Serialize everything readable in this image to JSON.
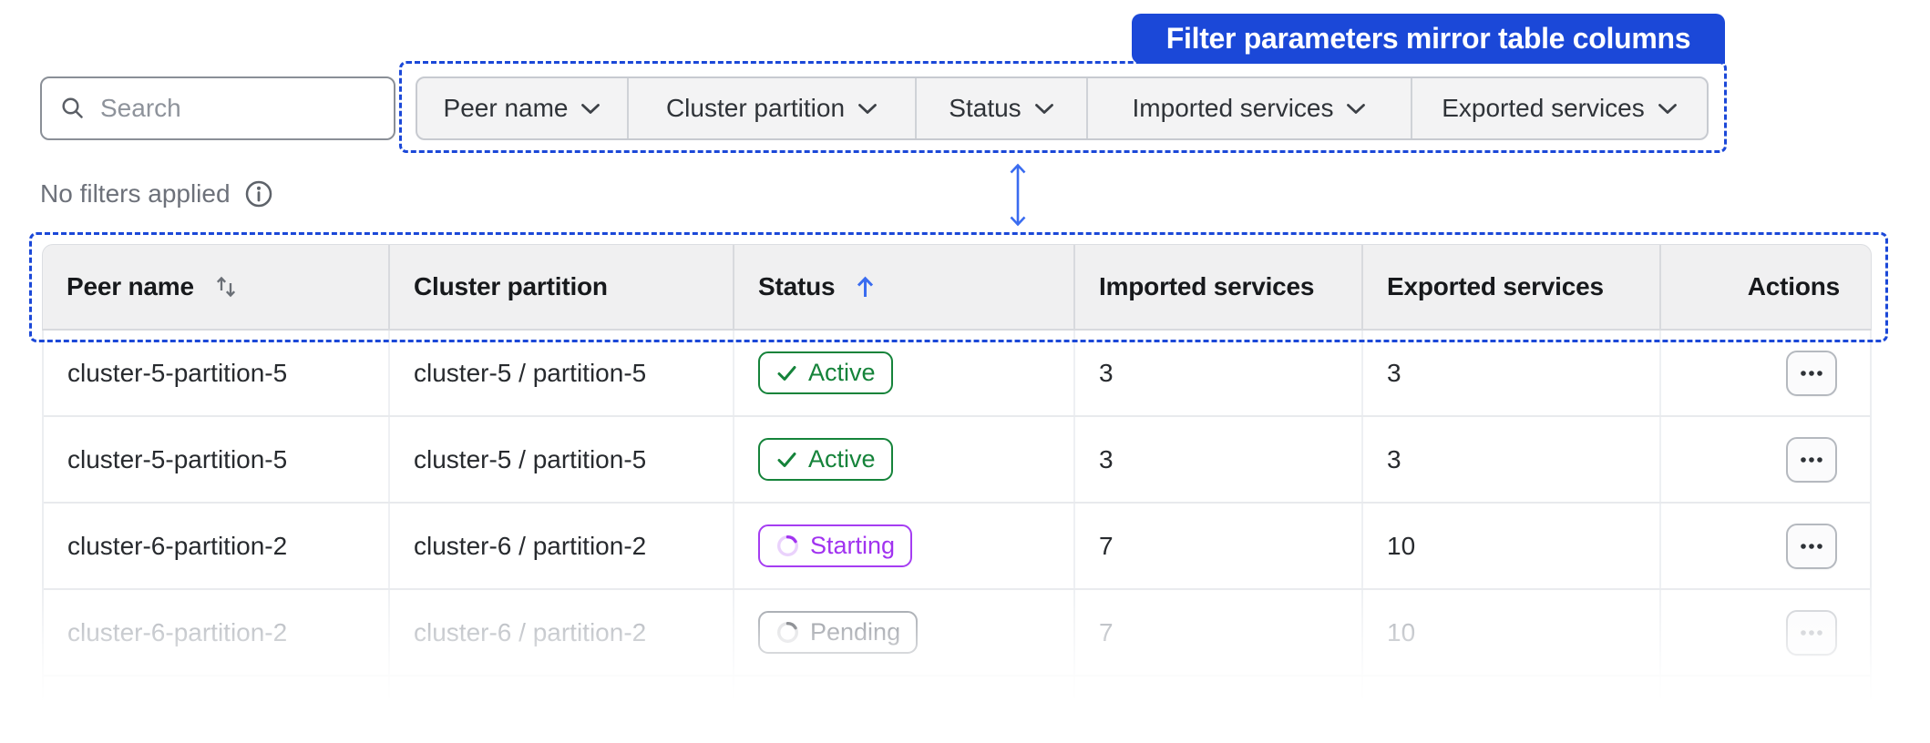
{
  "annotation": {
    "banner_label": "Filter parameters mirror table columns"
  },
  "toolbar": {
    "search_placeholder": "Search",
    "filters": [
      {
        "label": "Peer name"
      },
      {
        "label": "Cluster partition"
      },
      {
        "label": "Status"
      },
      {
        "label": "Imported services"
      },
      {
        "label": "Exported services"
      }
    ]
  },
  "filters_status": {
    "label": "No filters applied"
  },
  "table": {
    "columns": [
      {
        "label": "Peer name",
        "sort": "both"
      },
      {
        "label": "Cluster partition",
        "sort": "none"
      },
      {
        "label": "Status",
        "sort": "asc"
      },
      {
        "label": "Imported services",
        "sort": "none"
      },
      {
        "label": "Exported services",
        "sort": "none"
      },
      {
        "label": "Actions",
        "sort": "none"
      }
    ],
    "rows": [
      {
        "peer_name": "cluster-5-partition-5",
        "cluster_partition": "cluster-5 / partition-5",
        "status": "Active",
        "status_kind": "active",
        "imported": "3",
        "exported": "3",
        "faded": "false"
      },
      {
        "peer_name": "cluster-5-partition-5",
        "cluster_partition": "cluster-5 / partition-5",
        "status": "Active",
        "status_kind": "active",
        "imported": "3",
        "exported": "3",
        "faded": "false"
      },
      {
        "peer_name": "cluster-6-partition-2",
        "cluster_partition": "cluster-6 / partition-2",
        "status": "Starting",
        "status_kind": "starting",
        "imported": "7",
        "exported": "10",
        "faded": "false"
      },
      {
        "peer_name": "cluster-6-partition-2",
        "cluster_partition": "cluster-6 / partition-2",
        "status": "Pending",
        "status_kind": "pending",
        "imported": "7",
        "exported": "10",
        "faded": "true"
      }
    ]
  },
  "colors": {
    "accent": "#1b48d8",
    "accent_light": "#3a6cf0",
    "green": "#15833a",
    "purple": "#a53df2",
    "purple_text": "#a133f0",
    "gray_badge": "#767b84",
    "gray_badge_border": "#8f949c"
  }
}
